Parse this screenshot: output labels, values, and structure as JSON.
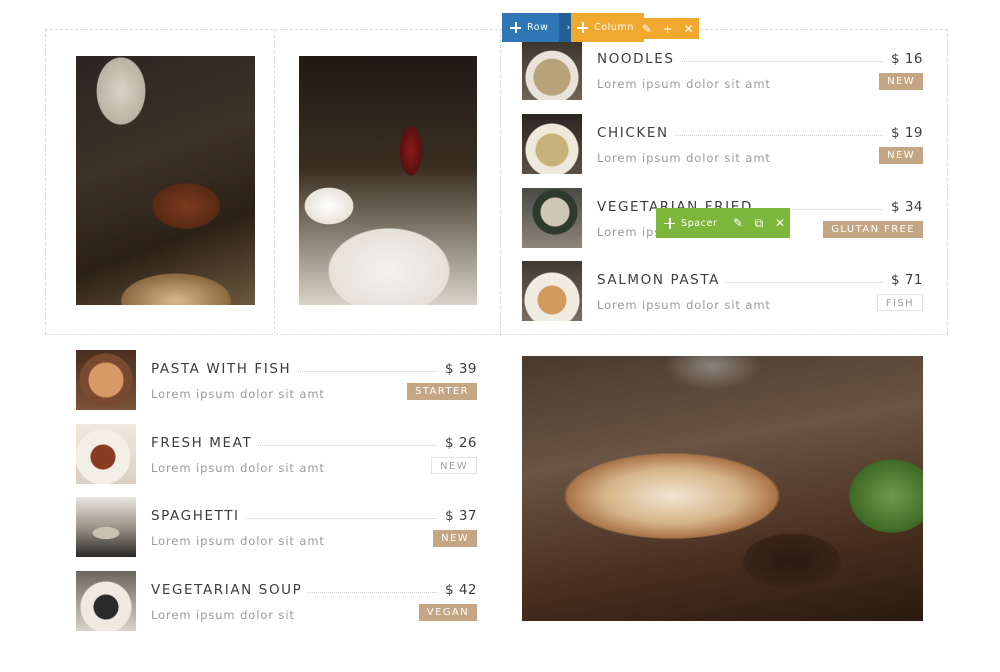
{
  "builder": {
    "row_toolbar": {
      "label": "Row",
      "expand_glyph": "›"
    },
    "column_toolbar": {
      "label": "Column",
      "actions": [
        "✎",
        "+",
        "✕"
      ]
    },
    "spacer_toolbar": {
      "label": "Spacer",
      "actions": [
        "✎",
        "⧉",
        "✕"
      ]
    }
  },
  "menu": {
    "top_right": [
      {
        "name": "NOODLES",
        "price": "$ 16",
        "desc": "Lorem ipsum dolor sit amt",
        "badge": "NEW",
        "badge_style": "filled",
        "thumb": "noodles-photo"
      },
      {
        "name": "CHICKEN",
        "price": "$ 19",
        "desc": "Lorem ipsum dolor sit amt",
        "badge": "NEW",
        "badge_style": "filled",
        "thumb": "chicken-photo"
      },
      {
        "name": "VEGETARIAN FRIED",
        "price": "$ 34",
        "desc": "Lorem ipsum dolor sit amt",
        "badge": "GLUTAN FREE",
        "badge_style": "filled",
        "thumb": "vegetarian-fried-photo"
      },
      {
        "name": "SALMON PASTA",
        "price": "$ 71",
        "desc": "Lorem ipsum dolor sit amt",
        "badge": "FISH",
        "badge_style": "outline",
        "thumb": "salmon-pasta-photo"
      }
    ],
    "bottom_left": [
      {
        "name": "PASTA WITH FISH",
        "price": "$ 39",
        "desc": "Lorem ipsum dolor sit amt",
        "badge": "STARTER",
        "badge_style": "filled",
        "thumb": "pasta-with-fish-photo"
      },
      {
        "name": "FRESH MEAT",
        "price": "$ 26",
        "desc": "Lorem ipsum dolor sit amt",
        "badge": "NEW",
        "badge_style": "outline",
        "thumb": "fresh-meat-photo"
      },
      {
        "name": "SPAGHETTI",
        "price": "$ 37",
        "desc": "Lorem ipsum dolor sit amt",
        "badge": "NEW",
        "badge_style": "filled",
        "thumb": "spaghetti-photo"
      },
      {
        "name": "VEGETARIAN SOUP",
        "price": "$ 42",
        "desc": "Lorem ipsum dolor sit",
        "badge": "VEGAN",
        "badge_style": "filled",
        "thumb": "vegetarian-soup-photo"
      }
    ]
  },
  "colors": {
    "badge_fill": "#c4a584",
    "row_toolbar": "#2f76b5",
    "column_toolbar": "#f0a92e",
    "spacer_toolbar": "#7cb63b"
  }
}
